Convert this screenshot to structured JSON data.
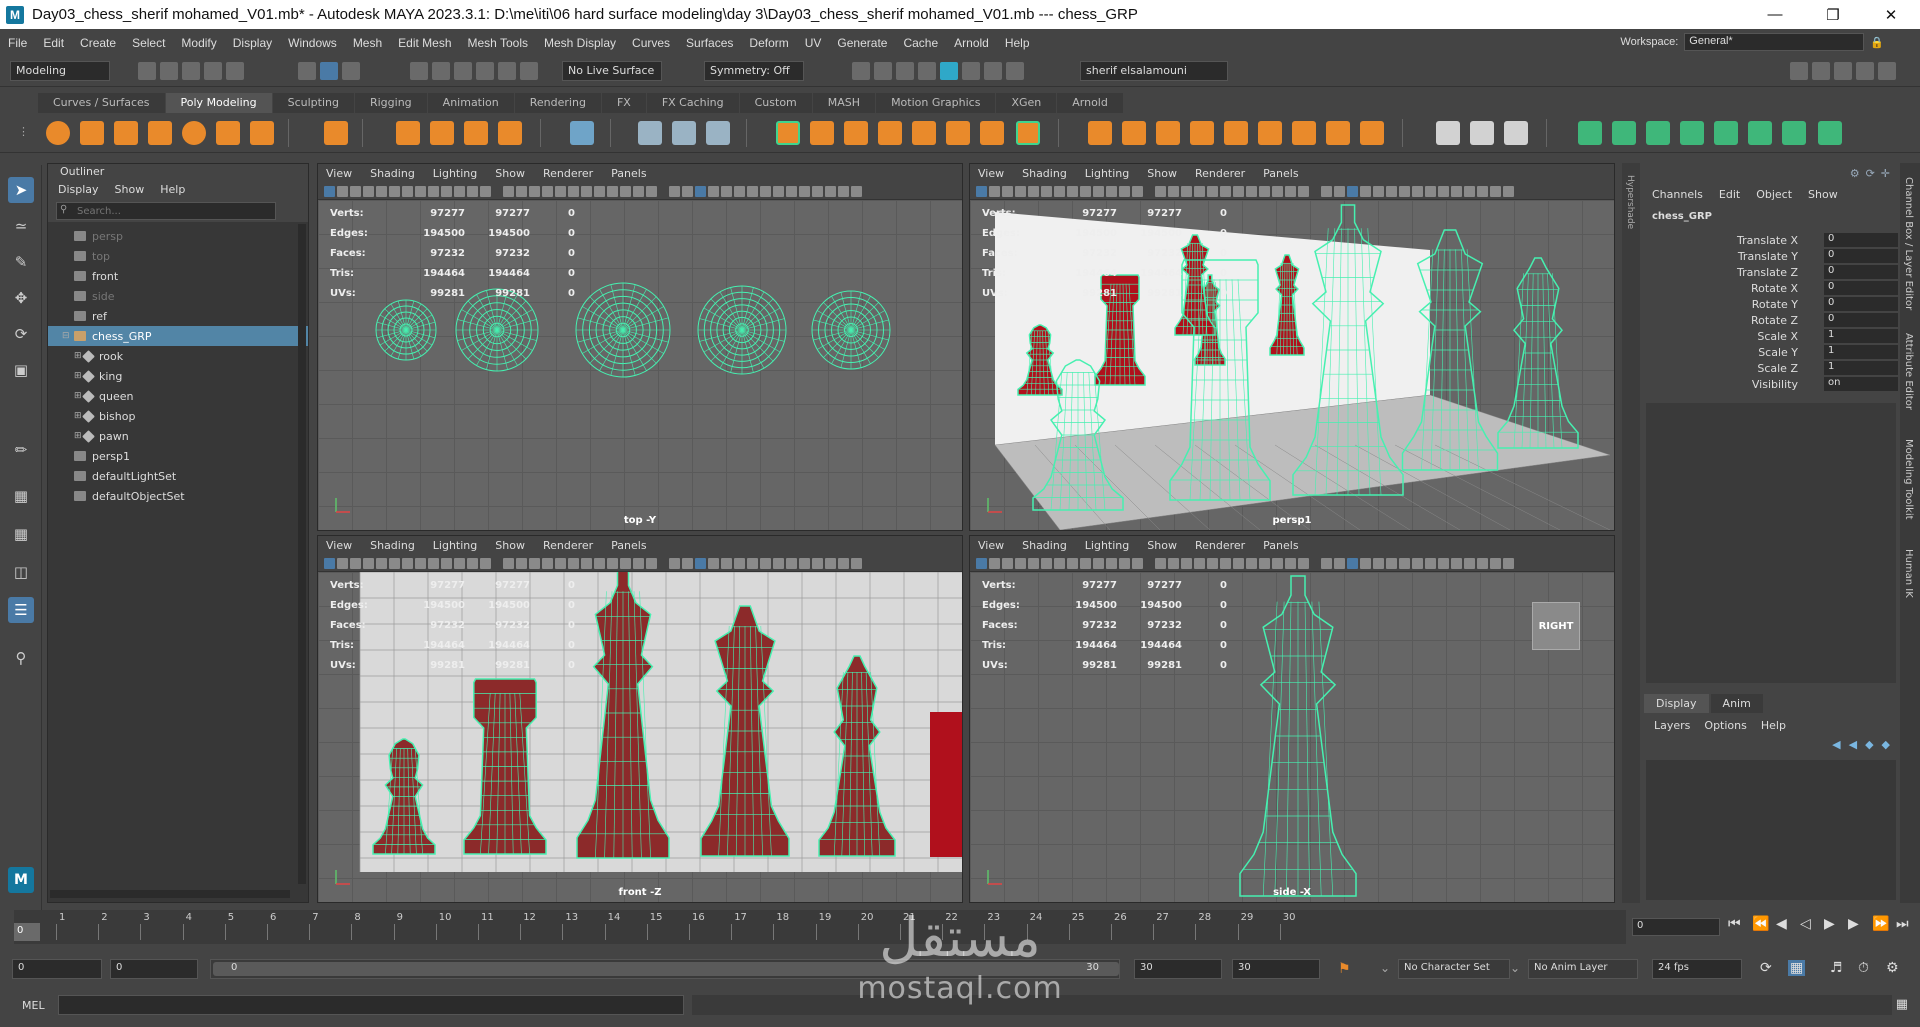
{
  "window": {
    "title": "Day03_chess_sherif mohamed_V01.mb* - Autodesk MAYA 2023.3.1: D:\\me\\iti\\06 hard surface modeling\\day 3\\Day03_chess_sherif mohamed_V01.mb   ---   chess_GRP",
    "logo": "M"
  },
  "menu": [
    "File",
    "Edit",
    "Create",
    "Select",
    "Modify",
    "Display",
    "Windows",
    "Mesh",
    "Edit Mesh",
    "Mesh Tools",
    "Mesh Display",
    "Curves",
    "Surfaces",
    "Deform",
    "UV",
    "Generate",
    "Cache",
    "Arnold",
    "Help"
  ],
  "workspace": {
    "label": "Workspace:",
    "value": "General*"
  },
  "status": {
    "menuset": "Modeling",
    "live_surface": "No Live Surface",
    "symmetry": "Symmetry: Off",
    "user": "sherif elsalamouni"
  },
  "shelf_tabs": [
    "Curves / Surfaces",
    "Poly Modeling",
    "Sculpting",
    "Rigging",
    "Animation",
    "Rendering",
    "FX",
    "FX Caching",
    "Custom",
    "MASH",
    "Motion Graphics",
    "XGen",
    "Arnold"
  ],
  "shelf_active": "Poly Modeling",
  "outliner": {
    "title": "Outliner",
    "menu": [
      "Display",
      "Show",
      "Help"
    ],
    "search_placeholder": "Search...",
    "items": [
      {
        "label": "persp",
        "indent": 0,
        "dim": true,
        "selected": false
      },
      {
        "label": "top",
        "indent": 0,
        "dim": true,
        "selected": false
      },
      {
        "label": "front",
        "indent": 0,
        "dim": false,
        "selected": false
      },
      {
        "label": "side",
        "indent": 0,
        "dim": true,
        "selected": false
      },
      {
        "label": "ref",
        "indent": 0,
        "dim": false,
        "selected": false
      },
      {
        "label": "chess_GRP",
        "indent": 0,
        "dim": false,
        "selected": true
      },
      {
        "label": "rook",
        "indent": 1,
        "dim": false,
        "selected": false
      },
      {
        "label": "king",
        "indent": 1,
        "dim": false,
        "selected": false
      },
      {
        "label": "queen",
        "indent": 1,
        "dim": false,
        "selected": false
      },
      {
        "label": "bishop",
        "indent": 1,
        "dim": false,
        "selected": false
      },
      {
        "label": "pawn",
        "indent": 1,
        "dim": false,
        "selected": false
      },
      {
        "label": "persp1",
        "indent": 0,
        "dim": false,
        "selected": false
      },
      {
        "label": "defaultLightSet",
        "indent": 0,
        "dim": false,
        "selected": false
      },
      {
        "label": "defaultObjectSet",
        "indent": 0,
        "dim": false,
        "selected": false
      }
    ]
  },
  "viewport_menu": [
    "View",
    "Shading",
    "Lighting",
    "Show",
    "Renderer",
    "Panels"
  ],
  "hud": {
    "rows": [
      {
        "label": "Verts:",
        "a": "97277",
        "b": "97277",
        "c": "0"
      },
      {
        "label": "Edges:",
        "a": "194500",
        "b": "194500",
        "c": "0"
      },
      {
        "label": "Faces:",
        "a": "97232",
        "b": "97232",
        "c": "0"
      },
      {
        "label": "Tris:",
        "a": "194464",
        "b": "194464",
        "c": "0"
      },
      {
        "label": "UVs:",
        "a": "99281",
        "b": "99281",
        "c": "0"
      }
    ]
  },
  "viewports": {
    "top": {
      "label": "top -Y"
    },
    "persp": {
      "label": "persp1"
    },
    "front": {
      "label": "front -Z"
    },
    "side": {
      "label": "side -X",
      "cube": "RIGHT"
    }
  },
  "channel_box": {
    "menu": [
      "Channels",
      "Edit",
      "Object",
      "Show"
    ],
    "object": "chess_GRP",
    "attrs": [
      {
        "name": "Translate X",
        "value": "0"
      },
      {
        "name": "Translate Y",
        "value": "0"
      },
      {
        "name": "Translate Z",
        "value": "0"
      },
      {
        "name": "Rotate X",
        "value": "0"
      },
      {
        "name": "Rotate Y",
        "value": "0"
      },
      {
        "name": "Rotate Z",
        "value": "0"
      },
      {
        "name": "Scale X",
        "value": "1"
      },
      {
        "name": "Scale Y",
        "value": "1"
      },
      {
        "name": "Scale Z",
        "value": "1"
      },
      {
        "name": "Visibility",
        "value": "on"
      }
    ]
  },
  "layer_editor": {
    "tabs": [
      "Display",
      "Anim"
    ],
    "menu": [
      "Layers",
      "Options",
      "Help"
    ]
  },
  "side_tabs": [
    "Channel Box / Layer Editor",
    "Attribute Editor",
    "Modeling Toolkit",
    "Human IK"
  ],
  "hypershade_tab": "Hypershade",
  "timeline": {
    "ticks": [
      "1",
      "2",
      "3",
      "4",
      "5",
      "6",
      "7",
      "8",
      "9",
      "10",
      "11",
      "12",
      "13",
      "14",
      "15",
      "16",
      "17",
      "18",
      "19",
      "20",
      "21",
      "22",
      "23",
      "24",
      "25",
      "26",
      "27",
      "28",
      "29",
      "30"
    ],
    "current": "0",
    "current_frame_field": "0"
  },
  "range": {
    "start": "0",
    "anim_start": "0",
    "slider_left": "0",
    "slider_right": "30",
    "anim_end": "30",
    "end": "30",
    "character_set": "No Character Set",
    "anim_layer": "No Anim Layer",
    "fps": "24 fps"
  },
  "command": {
    "label": "MEL"
  },
  "watermark": {
    "arabic": "مستقل",
    "latin": "mostaql.com"
  },
  "colors": {
    "wire": "#46f0b0",
    "piece": "#b0101c",
    "selection": "#5285a6",
    "accent_orange": "#e98a2b"
  }
}
